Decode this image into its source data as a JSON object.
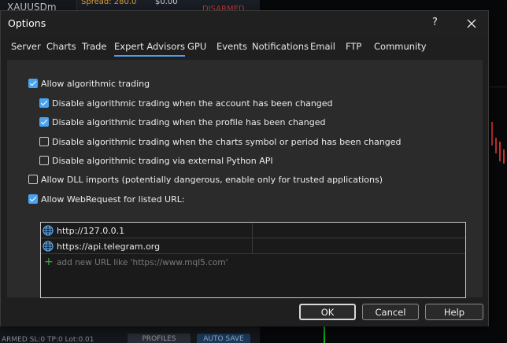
{
  "background": {
    "symbol": "XAUUSDm",
    "spread": "Spread: 280.0",
    "price": "$0.00",
    "disarmed": "DISARMED",
    "status": "ARMED SL:0 TP:0 Lot:0.01",
    "profiles_label": "PROFILES",
    "autosave_label": "AUTO SAVE"
  },
  "dialog": {
    "title": "Options",
    "help_label": "?",
    "close_icon": "close-icon"
  },
  "tabs": [
    {
      "label": "Server"
    },
    {
      "label": "Charts"
    },
    {
      "label": "Trade"
    },
    {
      "label": "Expert Advisors",
      "active": true
    },
    {
      "label": "GPU"
    },
    {
      "label": "Events"
    },
    {
      "label": "Notifications"
    },
    {
      "label": "Email"
    },
    {
      "label": "FTP"
    },
    {
      "label": "Community"
    }
  ],
  "options": [
    {
      "label": "Allow algorithmic trading",
      "checked": true
    },
    {
      "label": "Disable algorithmic trading when the account has been changed",
      "checked": true
    },
    {
      "label": "Disable algorithmic trading when the profile has been changed",
      "checked": true
    },
    {
      "label": "Disable algorithmic trading when the charts symbol or period has been changed",
      "checked": false
    },
    {
      "label": "Disable algorithmic trading via external Python API",
      "checked": false
    },
    {
      "label": "Allow DLL imports (potentially dangerous, enable only for trusted applications)",
      "checked": false
    },
    {
      "label": "Allow WebRequest for listed URL:",
      "checked": true
    }
  ],
  "urls": {
    "items": [
      "http://127.0.0.1",
      "https://api.telegram.org"
    ],
    "add_placeholder": "add new URL like 'https://www.mql5.com'",
    "icon": "globe-icon",
    "add_icon": "plus-icon"
  },
  "buttons": {
    "ok": "OK",
    "cancel": "Cancel",
    "help": "Help"
  },
  "colors": {
    "accent": "#4aa3f0",
    "add_icon": "#3da84a",
    "disarmed": "#d03a3a"
  }
}
